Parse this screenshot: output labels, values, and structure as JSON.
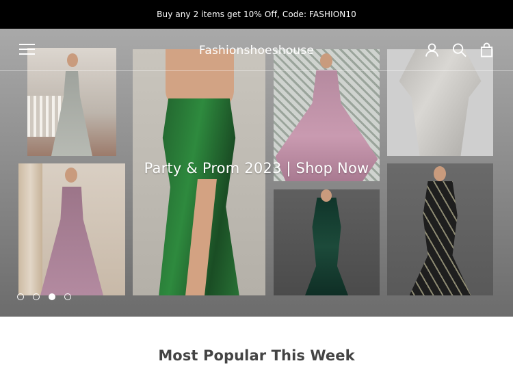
{
  "announcement": {
    "text": "Buy any 2 items get 10% Off, Code: FASHION10"
  },
  "header": {
    "logo": "Fashionshoeshouse",
    "icons": [
      "menu-icon",
      "account-icon",
      "search-icon",
      "cart-icon"
    ]
  },
  "hero": {
    "caption": "Party & Prom 2023 | Shop Now",
    "slides": {
      "count": 4,
      "active_index": 3
    }
  },
  "section": {
    "title": "Most Popular This Week"
  },
  "colors": {
    "announcement_bg": "#000000",
    "header_text": "#ffffff",
    "title_text": "#444444"
  }
}
